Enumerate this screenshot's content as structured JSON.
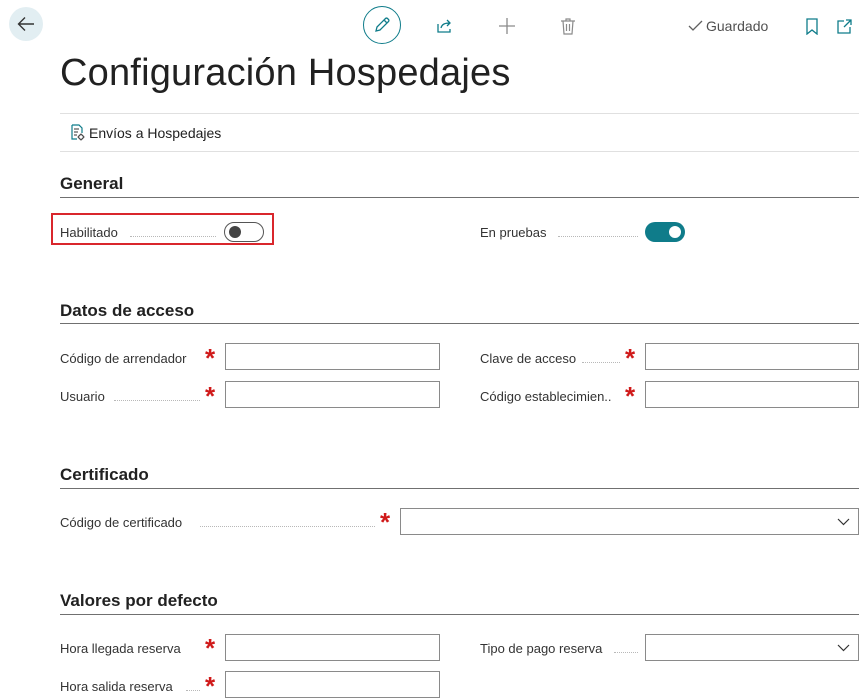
{
  "page": {
    "title": "Configuración Hospedajes",
    "saved_label": "Guardado"
  },
  "actions": {
    "envios_label": "Envíos a Hospedajes"
  },
  "sections": {
    "general": {
      "title": "General",
      "habilitado": {
        "label": "Habilitado",
        "value": false
      },
      "en_pruebas": {
        "label": "En pruebas",
        "value": true
      }
    },
    "datos_acceso": {
      "title": "Datos de acceso",
      "codigo_arrendador": {
        "label": "Código de arrendador",
        "value": ""
      },
      "usuario": {
        "label": "Usuario",
        "value": ""
      },
      "clave_acceso": {
        "label": "Clave de acceso",
        "value": ""
      },
      "codigo_establecimiento": {
        "label": "Código establecimien..",
        "value": ""
      }
    },
    "certificado": {
      "title": "Certificado",
      "codigo_certificado": {
        "label": "Código de certificado",
        "value": ""
      }
    },
    "valores_defecto": {
      "title": "Valores por defecto",
      "hora_llegada": {
        "label": "Hora llegada reserva",
        "value": ""
      },
      "hora_salida": {
        "label": "Hora salida reserva",
        "value": ""
      },
      "tipo_pago": {
        "label": "Tipo de pago reserva",
        "value": ""
      }
    }
  },
  "required_marker": "*",
  "icons": {
    "back": "arrow-left-icon",
    "edit": "pencil-icon",
    "share": "share-icon",
    "new": "plus-icon",
    "delete": "trash-icon",
    "saved": "checkmark-icon",
    "bookmark": "bookmark-icon",
    "open_new": "open-in-new-window-icon",
    "action": "document-gear-icon",
    "dropdown": "chevron-down-icon"
  },
  "colors": {
    "accent": "#0f7c8a",
    "required": "#d01a1a",
    "highlight": "#d9262c"
  }
}
